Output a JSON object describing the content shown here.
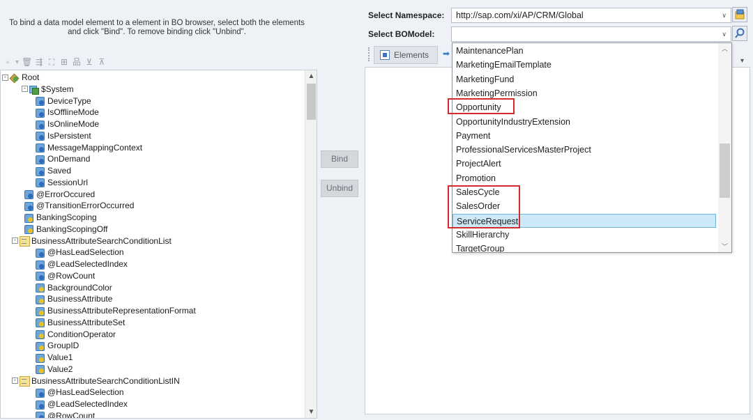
{
  "instructions": "To bind a data model element to a element in BO browser, select both the elements and click \"Bind\". To remove binding click \"Unbind\".",
  "tree": {
    "nodes": [
      {
        "label": "Root",
        "icon": "root-icon"
      },
      {
        "label": "$System",
        "icon": "group-icon"
      },
      {
        "label": "DeviceType",
        "icon": "field-icon"
      },
      {
        "label": "IsOfflineMode",
        "icon": "field-icon"
      },
      {
        "label": "IsOnlineMode",
        "icon": "field-icon"
      },
      {
        "label": "IsPersistent",
        "icon": "field-icon"
      },
      {
        "label": "MessageMappingContext",
        "icon": "field-icon"
      },
      {
        "label": "OnDemand",
        "icon": "field-icon"
      },
      {
        "label": "Saved",
        "icon": "field-icon"
      },
      {
        "label": "SessionUrl",
        "icon": "field-icon"
      },
      {
        "label": "@ErrorOccured",
        "icon": "field-icon"
      },
      {
        "label": "@TransitionErrorOccurred",
        "icon": "field-icon"
      },
      {
        "label": "BankingScoping",
        "icon": "field-icon"
      },
      {
        "label": "BankingScopingOff",
        "icon": "field-icon"
      },
      {
        "label": "BusinessAttributeSearchConditionList",
        "icon": "list-icon"
      },
      {
        "label": "@HasLeadSelection",
        "icon": "field-icon"
      },
      {
        "label": "@LeadSelectedIndex",
        "icon": "field-icon"
      },
      {
        "label": "@RowCount",
        "icon": "field-icon"
      },
      {
        "label": "BackgroundColor",
        "icon": "field-icon"
      },
      {
        "label": "BusinessAttribute",
        "icon": "field-icon"
      },
      {
        "label": "BusinessAttributeRepresentationFormat",
        "icon": "field-icon"
      },
      {
        "label": "BusinessAttributeSet",
        "icon": "field-icon"
      },
      {
        "label": "ConditionOperator",
        "icon": "field-icon"
      },
      {
        "label": "GroupID",
        "icon": "field-icon"
      },
      {
        "label": "Value1",
        "icon": "field-icon"
      },
      {
        "label": "Value2",
        "icon": "field-icon"
      },
      {
        "label": "BusinessAttributeSearchConditionListIN",
        "icon": "list-icon"
      },
      {
        "label": "@HasLeadSelection",
        "icon": "field-icon"
      },
      {
        "label": "@LeadSelectedIndex",
        "icon": "field-icon"
      },
      {
        "label": "@RowCount",
        "icon": "field-icon"
      }
    ]
  },
  "buttons": {
    "bind": "Bind",
    "unbind": "Unbind"
  },
  "namespace": {
    "label": "Select Namespace:",
    "value": "http://sap.com/xi/AP/CRM/Global"
  },
  "bomodel": {
    "label": "Select BOModel:",
    "value": ""
  },
  "tabs": {
    "elements": "Elements"
  },
  "dropdown": {
    "items": [
      "MaintenancePlan",
      "MarketingEmailTemplate",
      "MarketingFund",
      "MarketingPermission",
      "Opportunity",
      "OpportunityIndustryExtension",
      "Payment",
      "ProfessionalServicesMasterProject",
      "ProjectAlert",
      "Promotion",
      "SalesCycle",
      "SalesOrder",
      "ServiceRequest",
      "SkillHierarchy",
      "TargetGroup"
    ],
    "selected": "ServiceRequest",
    "highlighted": [
      "Opportunity",
      "SalesCycle",
      "SalesOrder",
      "ServiceRequest"
    ]
  },
  "colors": {
    "highlight_border": "#d42a2a",
    "selection_bg": "#cde8f7"
  }
}
